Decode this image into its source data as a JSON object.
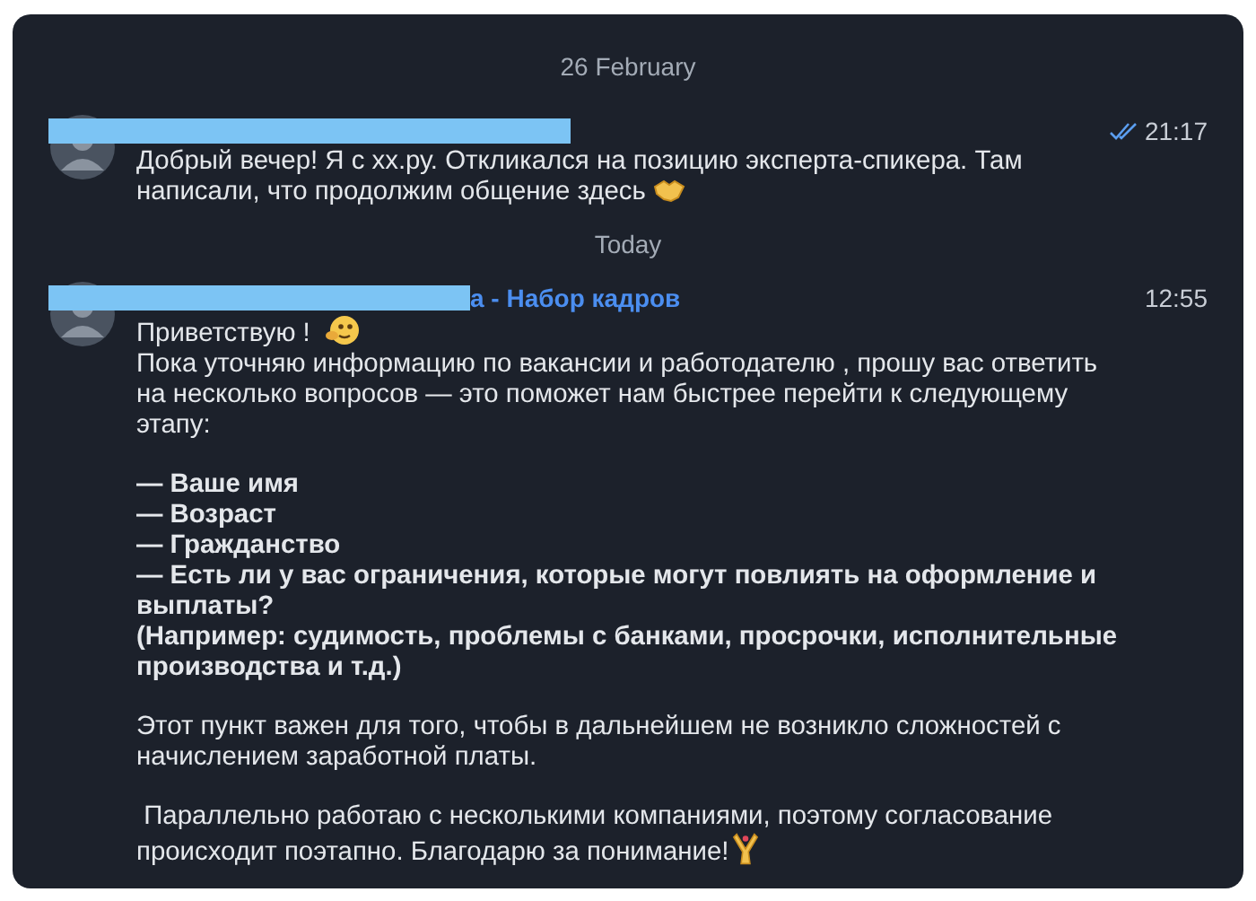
{
  "messages": [
    {
      "kind": "date",
      "label": "26 February"
    },
    {
      "kind": "message",
      "redacted": true,
      "time": "21:17",
      "read": true,
      "blocks": [
        {
          "lines": [
            {
              "text": "Добрый вечер! Я с xx.ру. Откликался на позицию эксперта-спикера. Там написали, что продолжим общение здесь",
              "bold": false,
              "emoji": true
            }
          ]
        }
      ]
    },
    {
      "kind": "date",
      "label": "Today"
    },
    {
      "kind": "message",
      "sender": "а - Набор кадров",
      "redacted": true,
      "time": "12:55",
      "blocks": [
        {
          "lines": [
            {
              "text": "Приветствую !",
              "bold": false,
              "emoji": true
            },
            {
              "text": "Пока уточняю информацию по вакансии и работодателю , прошу вас ответить на несколько вопросов — это поможет нам быстрее перейти к следующему этапу:",
              "bold": false
            }
          ]
        },
        {
          "lines": [
            {
              "text": "— Ваше имя",
              "bold": true
            },
            {
              "text": "— Возраст",
              "bold": true
            },
            {
              "text": "— Гражданство",
              "bold": true
            },
            {
              "text": "— Есть ли у вас ограничения, которые могут повлиять на оформление и выплаты?",
              "bold": true
            },
            {
              "text": "(Например: судимость, проблемы с банками, просрочки, исполнительные производства и т.д.)",
              "bold": true
            }
          ]
        },
        {
          "lines": [
            {
              "text": "Этот пункт важен для того, чтобы в дальнейшем не возникло сложностей с начислением заработной платы.",
              "bold": false
            }
          ]
        },
        {
          "lines": [
            {
              "text": " Параллельно работаю с несколькими компаниями, поэтому согласование происходит поэтапно. Благодарю за понимание!",
              "bold": false,
              "emoji": true
            }
          ]
        }
      ]
    }
  ]
}
